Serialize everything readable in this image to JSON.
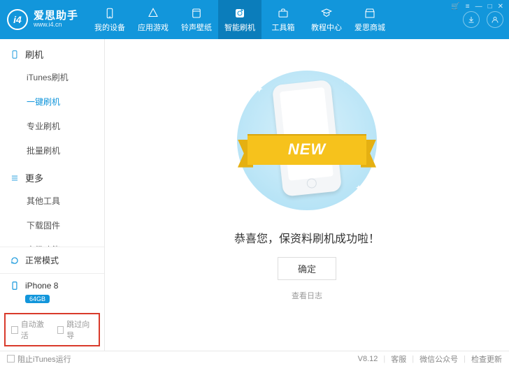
{
  "brand": {
    "title": "爱思助手",
    "subtitle": "www.i4.cn",
    "logo": "i4"
  },
  "nav": [
    {
      "label": "我的设备"
    },
    {
      "label": "应用游戏"
    },
    {
      "label": "铃声壁纸"
    },
    {
      "label": "智能刷机",
      "active": true
    },
    {
      "label": "工具箱"
    },
    {
      "label": "教程中心"
    },
    {
      "label": "爱思商城"
    }
  ],
  "window_controls": {
    "cart": "🛒",
    "menu": "≡",
    "min": "—",
    "max": "□",
    "close": "✕"
  },
  "sidebar": {
    "groups": [
      {
        "title": "刷机",
        "icon": "phone",
        "items": [
          "iTunes刷机",
          "一键刷机",
          "专业刷机",
          "批量刷机"
        ],
        "activeIndex": 1
      },
      {
        "title": "更多",
        "icon": "menu",
        "items": [
          "其他工具",
          "下载固件",
          "高级功能"
        ]
      }
    ],
    "mode": {
      "label": "正常模式"
    },
    "device": {
      "name": "iPhone 8",
      "badge": "64GB"
    },
    "checks": [
      {
        "label": "自动激活",
        "checked": false
      },
      {
        "label": "跳过向导",
        "checked": false
      }
    ]
  },
  "main": {
    "ribbon": "NEW",
    "message": "恭喜您，保资料刷机成功啦！",
    "ok": "确定",
    "view_log": "查看日志"
  },
  "statusbar": {
    "block_itunes": "阻止iTunes运行",
    "version": "V8.12",
    "links": [
      "客服",
      "微信公众号",
      "检查更新"
    ]
  }
}
